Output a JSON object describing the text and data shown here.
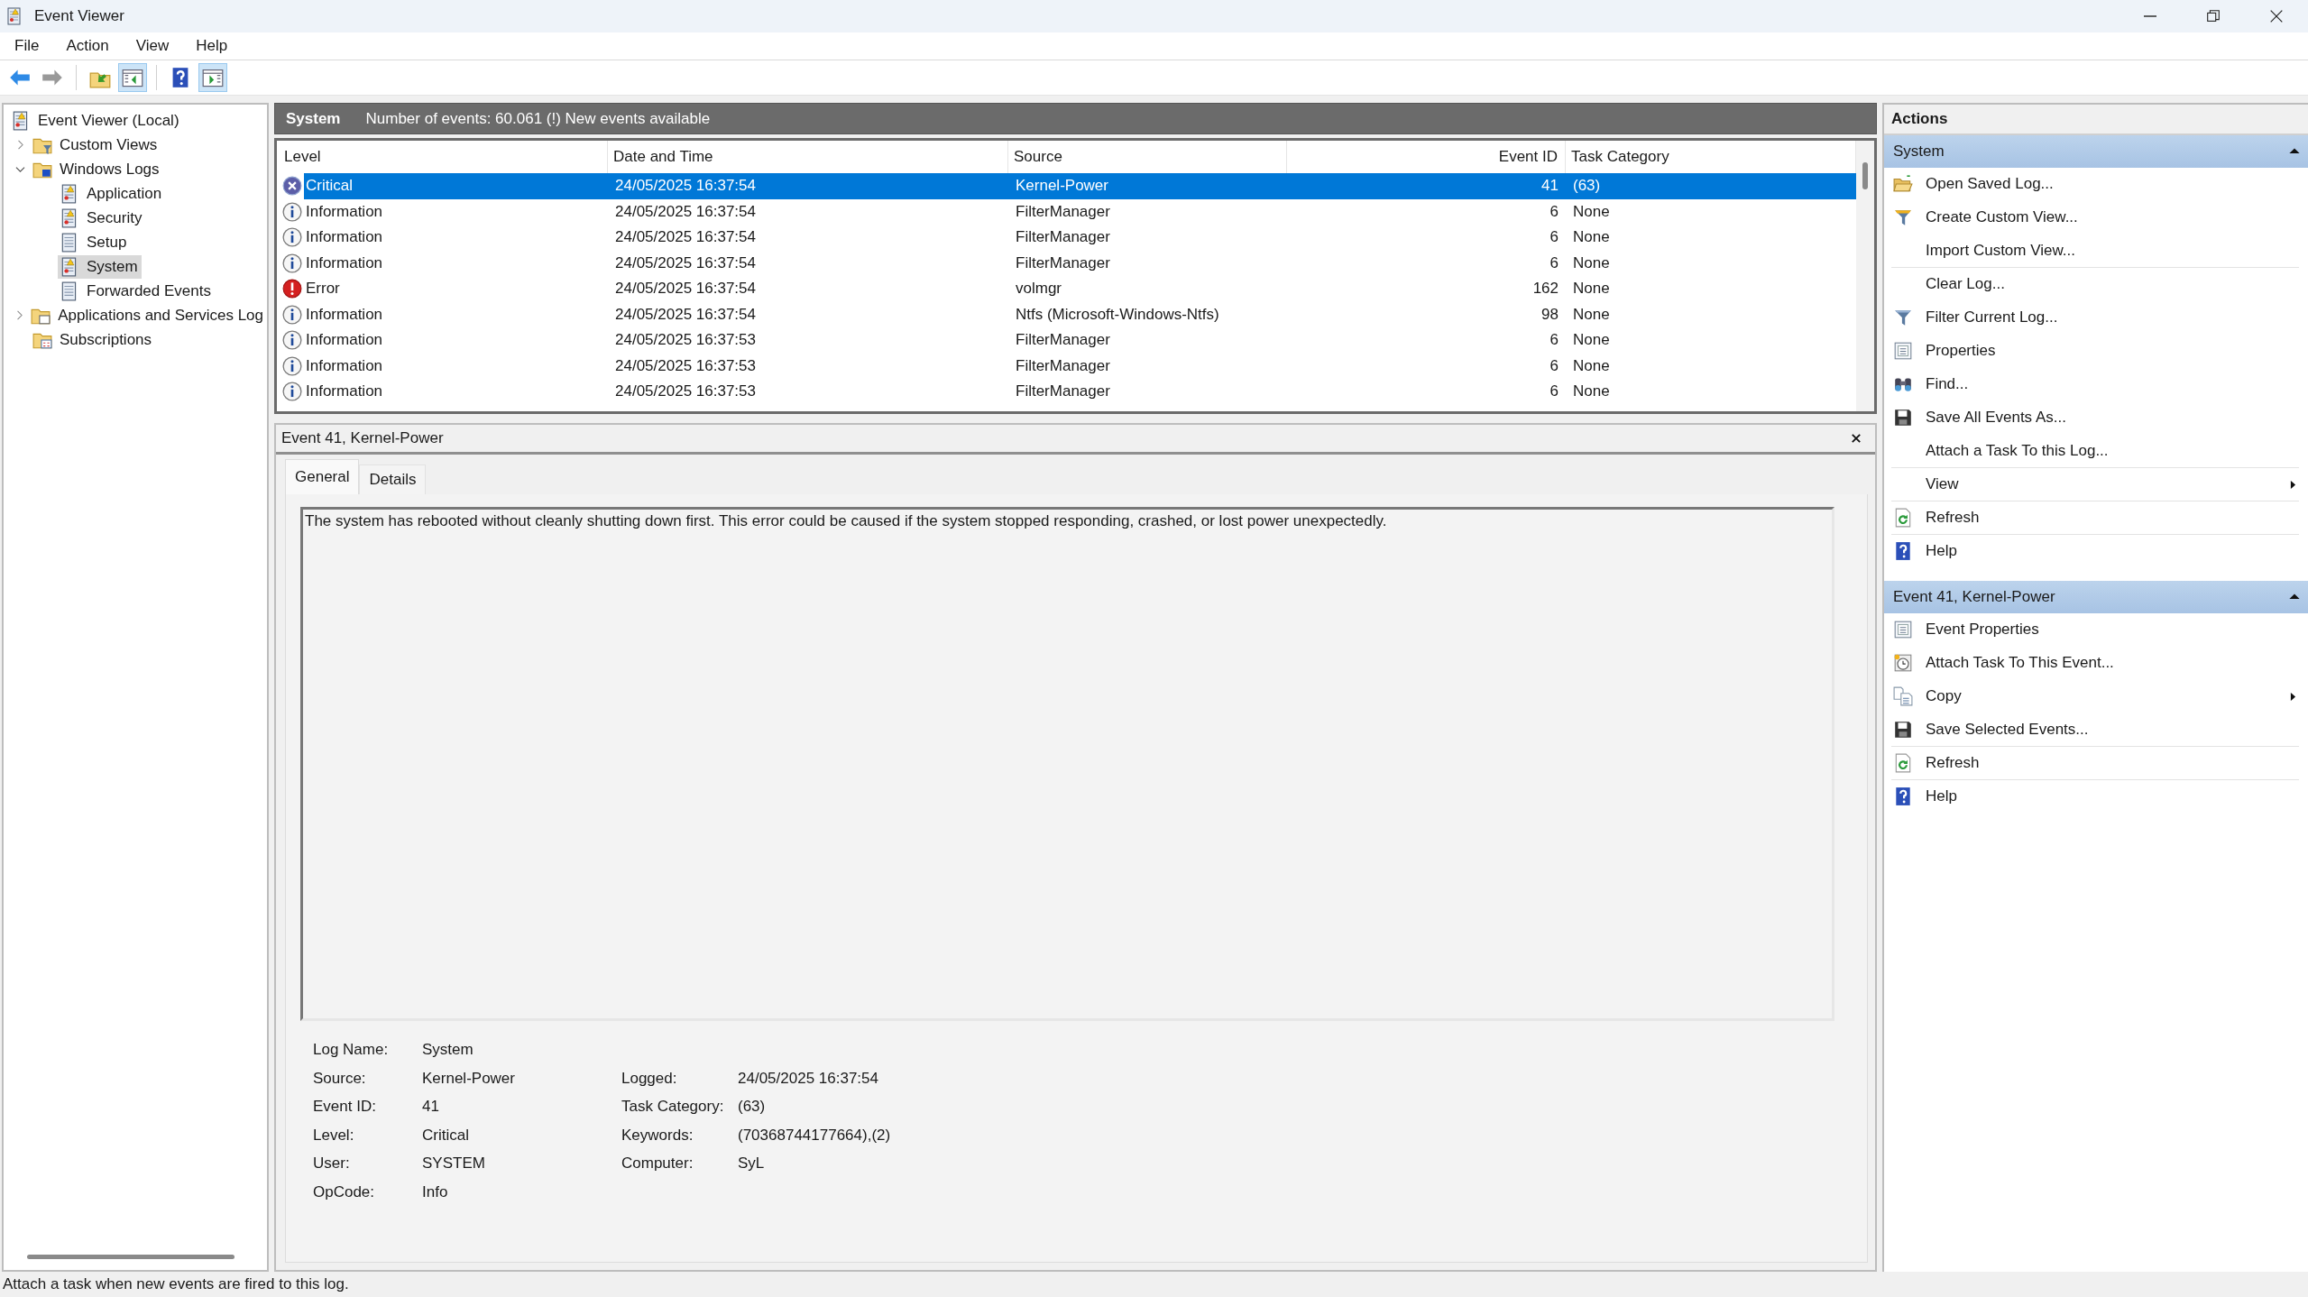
{
  "window": {
    "title": "Event Viewer"
  },
  "menu": [
    "File",
    "Action",
    "View",
    "Help"
  ],
  "toolbar": [
    {
      "kind": "back",
      "disabled": false,
      "pressed": false
    },
    {
      "kind": "forward",
      "disabled": true,
      "pressed": false
    },
    {
      "kind": "up-folder",
      "disabled": false,
      "pressed": false
    },
    {
      "kind": "pane-left",
      "disabled": false,
      "pressed": true
    },
    {
      "kind": "help",
      "disabled": false,
      "pressed": false
    },
    {
      "kind": "pane-right",
      "disabled": false,
      "pressed": true
    }
  ],
  "tree": [
    {
      "label": "Event Viewer (Local)",
      "kind": "log",
      "selected": false,
      "children": [
        {
          "label": "Custom Views",
          "kind": "folder-filter",
          "expanded": false,
          "selected": false
        },
        {
          "label": "Windows Logs",
          "kind": "folder-windows",
          "expanded": true,
          "selected": false,
          "children": [
            {
              "label": "Application",
              "kind": "log",
              "selected": false
            },
            {
              "label": "Security",
              "kind": "log",
              "selected": false
            },
            {
              "label": "Setup",
              "kind": "log-plain",
              "selected": false
            },
            {
              "label": "System",
              "kind": "log",
              "selected": true
            },
            {
              "label": "Forwarded Events",
              "kind": "log-plain",
              "selected": false
            }
          ]
        },
        {
          "label": "Applications and Services Log",
          "kind": "folder-pane",
          "expanded": false,
          "selected": false
        },
        {
          "label": "Subscriptions",
          "kind": "folder-subscriptions",
          "selected": false
        }
      ]
    }
  ],
  "log_header": {
    "name": "System",
    "summary": "Number of events: 60.061 (!) New events available"
  },
  "events": {
    "columns": [
      "Level",
      "Date and Time",
      "Source",
      "Event ID",
      "Task Category"
    ],
    "rows": [
      {
        "kind": "critical",
        "cells": [
          "Critical",
          "24/05/2025 16:37:54",
          "Kernel-Power",
          "41",
          "(63)"
        ],
        "selected": true
      },
      {
        "kind": "information",
        "cells": [
          "Information",
          "24/05/2025 16:37:54",
          "FilterManager",
          "6",
          "None"
        ],
        "selected": false
      },
      {
        "kind": "information",
        "cells": [
          "Information",
          "24/05/2025 16:37:54",
          "FilterManager",
          "6",
          "None"
        ],
        "selected": false
      },
      {
        "kind": "information",
        "cells": [
          "Information",
          "24/05/2025 16:37:54",
          "FilterManager",
          "6",
          "None"
        ],
        "selected": false
      },
      {
        "kind": "error",
        "cells": [
          "Error",
          "24/05/2025 16:37:54",
          "volmgr",
          "162",
          "None"
        ],
        "selected": false
      },
      {
        "kind": "information",
        "cells": [
          "Information",
          "24/05/2025 16:37:54",
          "Ntfs (Microsoft-Windows-Ntfs)",
          "98",
          "None"
        ],
        "selected": false
      },
      {
        "kind": "information",
        "cells": [
          "Information",
          "24/05/2025 16:37:53",
          "FilterManager",
          "6",
          "None"
        ],
        "selected": false
      },
      {
        "kind": "information",
        "cells": [
          "Information",
          "24/05/2025 16:37:53",
          "FilterManager",
          "6",
          "None"
        ],
        "selected": false
      },
      {
        "kind": "information",
        "cells": [
          "Information",
          "24/05/2025 16:37:53",
          "FilterManager",
          "6",
          "None"
        ],
        "selected": false
      }
    ]
  },
  "detail": {
    "title": "Event 41, Kernel-Power",
    "tabs": [
      {
        "label": "General",
        "selected": true
      },
      {
        "label": "Details",
        "selected": false
      }
    ],
    "description": "The system has rebooted without cleanly shutting down first. This error could be caused if the system stopped responding, crashed, or lost power unexpectedly.",
    "fields": [
      {
        "left": {
          "label": "Log Name:",
          "value": "System"
        }
      },
      {
        "left": {
          "label": "Source:",
          "value": "Kernel-Power"
        },
        "right": {
          "label": "Logged:",
          "value": "24/05/2025 16:37:54"
        }
      },
      {
        "left": {
          "label": "Event ID:",
          "value": "41"
        },
        "right": {
          "label": "Task Category:",
          "value": "(63)"
        }
      },
      {
        "left": {
          "label": "Level:",
          "value": "Critical"
        },
        "right": {
          "label": "Keywords:",
          "value": "(70368744177664),(2)"
        }
      },
      {
        "left": {
          "label": "User:",
          "value": "SYSTEM"
        },
        "right": {
          "label": "Computer:",
          "value": "SyL"
        }
      },
      {
        "left": {
          "label": "OpCode:",
          "value": "Info"
        }
      }
    ]
  },
  "actions": {
    "title": "Actions",
    "groups": [
      {
        "title": "System",
        "expanded": true,
        "items": [
          {
            "label": "Open Saved Log...",
            "kind": "open-folder",
            "submenu": false,
            "separator_after": false
          },
          {
            "label": "Create Custom View...",
            "kind": "funnel-star",
            "submenu": false,
            "separator_after": false
          },
          {
            "label": "Import Custom View...",
            "kind": "plain",
            "submenu": false,
            "separator_after": true
          },
          {
            "label": "Clear Log...",
            "kind": "plain",
            "submenu": false,
            "separator_after": false
          },
          {
            "label": "Filter Current Log...",
            "kind": "funnel",
            "submenu": false,
            "separator_after": false
          },
          {
            "label": "Properties",
            "kind": "properties",
            "submenu": false,
            "separator_after": false
          },
          {
            "label": "Find...",
            "kind": "binoculars",
            "submenu": false,
            "separator_after": false
          },
          {
            "label": "Save All Events As...",
            "kind": "floppy",
            "submenu": false,
            "separator_after": false
          },
          {
            "label": "Attach a Task To this Log...",
            "kind": "plain",
            "submenu": false,
            "separator_after": true
          },
          {
            "label": "View",
            "kind": "plain",
            "submenu": true,
            "separator_after": true
          },
          {
            "label": "Refresh",
            "kind": "refresh",
            "submenu": false,
            "separator_after": true
          },
          {
            "label": "Help",
            "kind": "help",
            "submenu": false,
            "separator_after": false
          }
        ]
      },
      {
        "title": "Event 41, Kernel-Power",
        "expanded": true,
        "items": [
          {
            "label": "Event Properties",
            "kind": "properties",
            "submenu": false,
            "separator_after": false
          },
          {
            "label": "Attach Task To This Event...",
            "kind": "clock",
            "submenu": false,
            "separator_after": false
          },
          {
            "label": "Copy",
            "kind": "copy",
            "submenu": true,
            "separator_after": false
          },
          {
            "label": "Save Selected Events...",
            "kind": "floppy",
            "submenu": false,
            "separator_after": true
          },
          {
            "label": "Refresh",
            "kind": "refresh",
            "submenu": false,
            "separator_after": true
          },
          {
            "label": "Help",
            "kind": "help",
            "submenu": false,
            "separator_after": false
          }
        ]
      }
    ]
  },
  "status_bar": "Attach a task when new events are fired to this log."
}
